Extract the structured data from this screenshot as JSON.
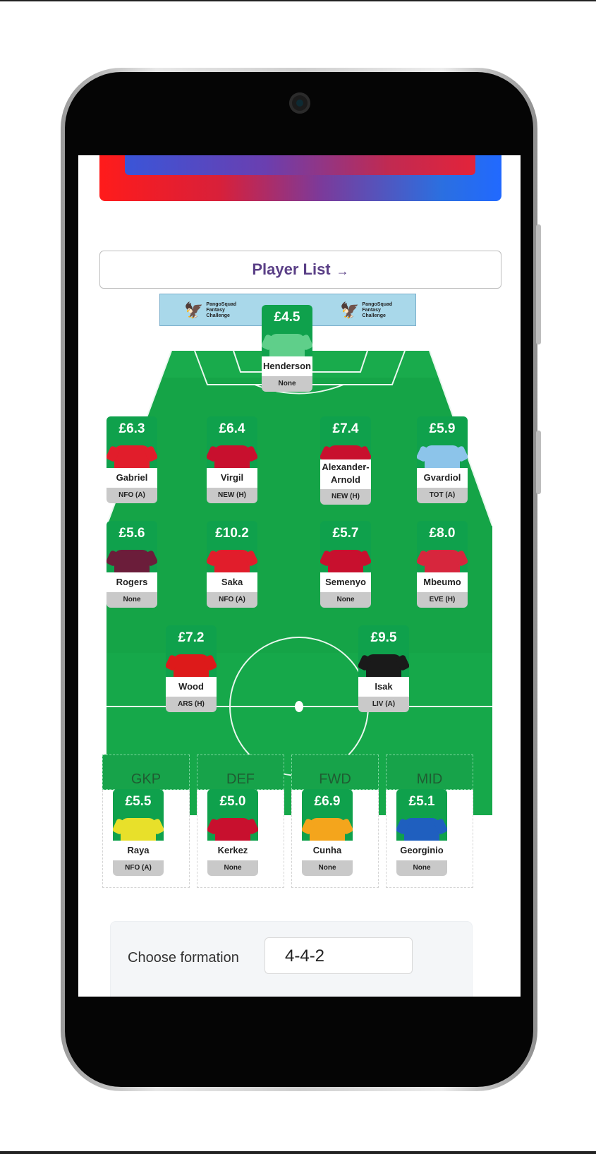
{
  "player_list_button": {
    "label": "Player List",
    "arrow": "→"
  },
  "boards": {
    "brand": "PangoSquad",
    "sub": "Fantasy Challenge"
  },
  "starters": [
    {
      "price": "£4.5",
      "name": "Henderson",
      "fixture": "None",
      "shirt_color": "#5fcf8a"
    },
    {
      "price": "£6.3",
      "name": "Gabriel",
      "fixture": "NFO (A)",
      "shirt_color": "#e11d2b"
    },
    {
      "price": "£6.4",
      "name": "Virgil",
      "fixture": "NEW (H)",
      "shirt_color": "#c8102e"
    },
    {
      "price": "£7.4",
      "name": "Alexander-Arnold",
      "fixture": "NEW (H)",
      "shirt_color": "#c8102e"
    },
    {
      "price": "£5.9",
      "name": "Gvardiol",
      "fixture": "TOT (A)",
      "shirt_color": "#8cc4ea"
    },
    {
      "price": "£5.6",
      "name": "Rogers",
      "fixture": "None",
      "shirt_color": "#6b1d3a"
    },
    {
      "price": "£10.2",
      "name": "Saka",
      "fixture": "NFO (A)",
      "shirt_color": "#e11d2b"
    },
    {
      "price": "£5.7",
      "name": "Semenyo",
      "fixture": "None",
      "shirt_color": "#c8102e"
    },
    {
      "price": "£8.0",
      "name": "Mbeumo",
      "fixture": "EVE (H)",
      "shirt_color": "#d7263d"
    },
    {
      "price": "£7.2",
      "name": "Wood",
      "fixture": "ARS (H)",
      "shirt_color": "#dd1a1a"
    },
    {
      "price": "£9.5",
      "name": "Isak",
      "fixture": "LIV (A)",
      "shirt_color": "#1a1a1a"
    }
  ],
  "bench_labels": [
    "GKP",
    "DEF",
    "FWD",
    "MID"
  ],
  "bench": [
    {
      "price": "£5.5",
      "name": "Raya",
      "fixture": "NFO (A)",
      "shirt_color": "#e8e02a"
    },
    {
      "price": "£5.0",
      "name": "Kerkez",
      "fixture": "None",
      "shirt_color": "#c8102e"
    },
    {
      "price": "£6.9",
      "name": "Cunha",
      "fixture": "None",
      "shirt_color": "#f4a51c"
    },
    {
      "price": "£5.1",
      "name": "Georginio",
      "fixture": "None",
      "shirt_color": "#1f5fbf"
    }
  ],
  "formation": {
    "label": "Choose formation",
    "value": "4-4-2"
  },
  "colors": {
    "pitch": "#15a447",
    "price_bg": "#0fa14c",
    "accent": "#5a3f86"
  }
}
